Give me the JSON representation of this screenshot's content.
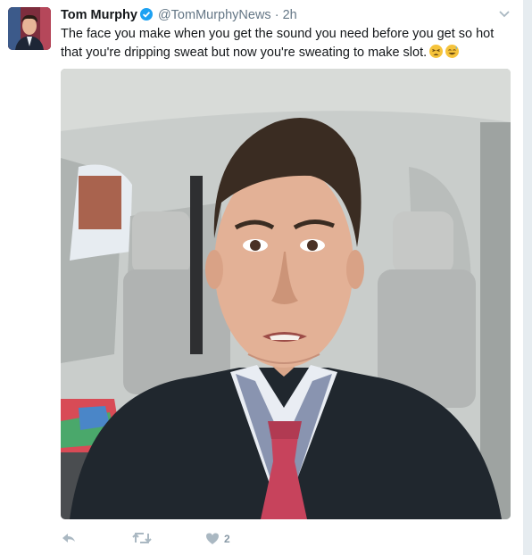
{
  "tweet": {
    "author_name": "Tom Murphy",
    "handle": "@TomMurphyNews",
    "separator": "·",
    "time": "2h",
    "text": "The face you make when you get the sound you need before you get so hot that you're dripping sweat but now you're sweating to make slot.",
    "emojis": [
      "tired-face",
      "grinning-sweat-face"
    ],
    "like_count": "2"
  },
  "icons": {
    "verified": "verified-badge-icon",
    "more": "chevron-down-icon",
    "reply": "reply-icon",
    "retweet": "retweet-icon",
    "like": "heart-icon"
  },
  "colors": {
    "verified_blue": "#1da1f2",
    "text": "#14171a",
    "secondary": "#657786",
    "action_grey": "#aab8c2"
  }
}
